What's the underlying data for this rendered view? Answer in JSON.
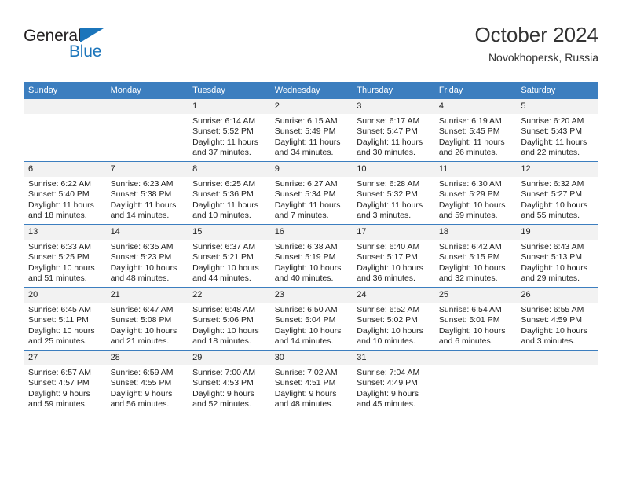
{
  "brand": {
    "name_part1": "General",
    "name_part2": "Blue",
    "accent_color": "#1b75bb"
  },
  "header": {
    "title": "October 2024",
    "subtitle": "Novokhopersk, Russia"
  },
  "theme": {
    "header_blue": "#3c7ebf",
    "daynum_bg": "#f2f2f2",
    "text": "#222222"
  },
  "weekdays": [
    "Sunday",
    "Monday",
    "Tuesday",
    "Wednesday",
    "Thursday",
    "Friday",
    "Saturday"
  ],
  "labels": {
    "sunrise_prefix": "Sunrise:",
    "sunset_prefix": "Sunset:",
    "daylight_prefix": "Daylight:"
  },
  "weeks": [
    [
      {
        "day": "",
        "blank": true
      },
      {
        "day": "",
        "blank": true
      },
      {
        "day": "1",
        "sunrise": "Sunrise: 6:14 AM",
        "sunset": "Sunset: 5:52 PM",
        "daylight1": "Daylight: 11 hours",
        "daylight2": "and 37 minutes."
      },
      {
        "day": "2",
        "sunrise": "Sunrise: 6:15 AM",
        "sunset": "Sunset: 5:49 PM",
        "daylight1": "Daylight: 11 hours",
        "daylight2": "and 34 minutes."
      },
      {
        "day": "3",
        "sunrise": "Sunrise: 6:17 AM",
        "sunset": "Sunset: 5:47 PM",
        "daylight1": "Daylight: 11 hours",
        "daylight2": "and 30 minutes."
      },
      {
        "day": "4",
        "sunrise": "Sunrise: 6:19 AM",
        "sunset": "Sunset: 5:45 PM",
        "daylight1": "Daylight: 11 hours",
        "daylight2": "and 26 minutes."
      },
      {
        "day": "5",
        "sunrise": "Sunrise: 6:20 AM",
        "sunset": "Sunset: 5:43 PM",
        "daylight1": "Daylight: 11 hours",
        "daylight2": "and 22 minutes."
      }
    ],
    [
      {
        "day": "6",
        "sunrise": "Sunrise: 6:22 AM",
        "sunset": "Sunset: 5:40 PM",
        "daylight1": "Daylight: 11 hours",
        "daylight2": "and 18 minutes."
      },
      {
        "day": "7",
        "sunrise": "Sunrise: 6:23 AM",
        "sunset": "Sunset: 5:38 PM",
        "daylight1": "Daylight: 11 hours",
        "daylight2": "and 14 minutes."
      },
      {
        "day": "8",
        "sunrise": "Sunrise: 6:25 AM",
        "sunset": "Sunset: 5:36 PM",
        "daylight1": "Daylight: 11 hours",
        "daylight2": "and 10 minutes."
      },
      {
        "day": "9",
        "sunrise": "Sunrise: 6:27 AM",
        "sunset": "Sunset: 5:34 PM",
        "daylight1": "Daylight: 11 hours",
        "daylight2": "and 7 minutes."
      },
      {
        "day": "10",
        "sunrise": "Sunrise: 6:28 AM",
        "sunset": "Sunset: 5:32 PM",
        "daylight1": "Daylight: 11 hours",
        "daylight2": "and 3 minutes."
      },
      {
        "day": "11",
        "sunrise": "Sunrise: 6:30 AM",
        "sunset": "Sunset: 5:29 PM",
        "daylight1": "Daylight: 10 hours",
        "daylight2": "and 59 minutes."
      },
      {
        "day": "12",
        "sunrise": "Sunrise: 6:32 AM",
        "sunset": "Sunset: 5:27 PM",
        "daylight1": "Daylight: 10 hours",
        "daylight2": "and 55 minutes."
      }
    ],
    [
      {
        "day": "13",
        "sunrise": "Sunrise: 6:33 AM",
        "sunset": "Sunset: 5:25 PM",
        "daylight1": "Daylight: 10 hours",
        "daylight2": "and 51 minutes."
      },
      {
        "day": "14",
        "sunrise": "Sunrise: 6:35 AM",
        "sunset": "Sunset: 5:23 PM",
        "daylight1": "Daylight: 10 hours",
        "daylight2": "and 48 minutes."
      },
      {
        "day": "15",
        "sunrise": "Sunrise: 6:37 AM",
        "sunset": "Sunset: 5:21 PM",
        "daylight1": "Daylight: 10 hours",
        "daylight2": "and 44 minutes."
      },
      {
        "day": "16",
        "sunrise": "Sunrise: 6:38 AM",
        "sunset": "Sunset: 5:19 PM",
        "daylight1": "Daylight: 10 hours",
        "daylight2": "and 40 minutes."
      },
      {
        "day": "17",
        "sunrise": "Sunrise: 6:40 AM",
        "sunset": "Sunset: 5:17 PM",
        "daylight1": "Daylight: 10 hours",
        "daylight2": "and 36 minutes."
      },
      {
        "day": "18",
        "sunrise": "Sunrise: 6:42 AM",
        "sunset": "Sunset: 5:15 PM",
        "daylight1": "Daylight: 10 hours",
        "daylight2": "and 32 minutes."
      },
      {
        "day": "19",
        "sunrise": "Sunrise: 6:43 AM",
        "sunset": "Sunset: 5:13 PM",
        "daylight1": "Daylight: 10 hours",
        "daylight2": "and 29 minutes."
      }
    ],
    [
      {
        "day": "20",
        "sunrise": "Sunrise: 6:45 AM",
        "sunset": "Sunset: 5:11 PM",
        "daylight1": "Daylight: 10 hours",
        "daylight2": "and 25 minutes."
      },
      {
        "day": "21",
        "sunrise": "Sunrise: 6:47 AM",
        "sunset": "Sunset: 5:08 PM",
        "daylight1": "Daylight: 10 hours",
        "daylight2": "and 21 minutes."
      },
      {
        "day": "22",
        "sunrise": "Sunrise: 6:48 AM",
        "sunset": "Sunset: 5:06 PM",
        "daylight1": "Daylight: 10 hours",
        "daylight2": "and 18 minutes."
      },
      {
        "day": "23",
        "sunrise": "Sunrise: 6:50 AM",
        "sunset": "Sunset: 5:04 PM",
        "daylight1": "Daylight: 10 hours",
        "daylight2": "and 14 minutes."
      },
      {
        "day": "24",
        "sunrise": "Sunrise: 6:52 AM",
        "sunset": "Sunset: 5:02 PM",
        "daylight1": "Daylight: 10 hours",
        "daylight2": "and 10 minutes."
      },
      {
        "day": "25",
        "sunrise": "Sunrise: 6:54 AM",
        "sunset": "Sunset: 5:01 PM",
        "daylight1": "Daylight: 10 hours",
        "daylight2": "and 6 minutes."
      },
      {
        "day": "26",
        "sunrise": "Sunrise: 6:55 AM",
        "sunset": "Sunset: 4:59 PM",
        "daylight1": "Daylight: 10 hours",
        "daylight2": "and 3 minutes."
      }
    ],
    [
      {
        "day": "27",
        "sunrise": "Sunrise: 6:57 AM",
        "sunset": "Sunset: 4:57 PM",
        "daylight1": "Daylight: 9 hours",
        "daylight2": "and 59 minutes."
      },
      {
        "day": "28",
        "sunrise": "Sunrise: 6:59 AM",
        "sunset": "Sunset: 4:55 PM",
        "daylight1": "Daylight: 9 hours",
        "daylight2": "and 56 minutes."
      },
      {
        "day": "29",
        "sunrise": "Sunrise: 7:00 AM",
        "sunset": "Sunset: 4:53 PM",
        "daylight1": "Daylight: 9 hours",
        "daylight2": "and 52 minutes."
      },
      {
        "day": "30",
        "sunrise": "Sunrise: 7:02 AM",
        "sunset": "Sunset: 4:51 PM",
        "daylight1": "Daylight: 9 hours",
        "daylight2": "and 48 minutes."
      },
      {
        "day": "31",
        "sunrise": "Sunrise: 7:04 AM",
        "sunset": "Sunset: 4:49 PM",
        "daylight1": "Daylight: 9 hours",
        "daylight2": "and 45 minutes."
      },
      {
        "day": "",
        "blank": true
      },
      {
        "day": "",
        "blank": true
      }
    ]
  ]
}
